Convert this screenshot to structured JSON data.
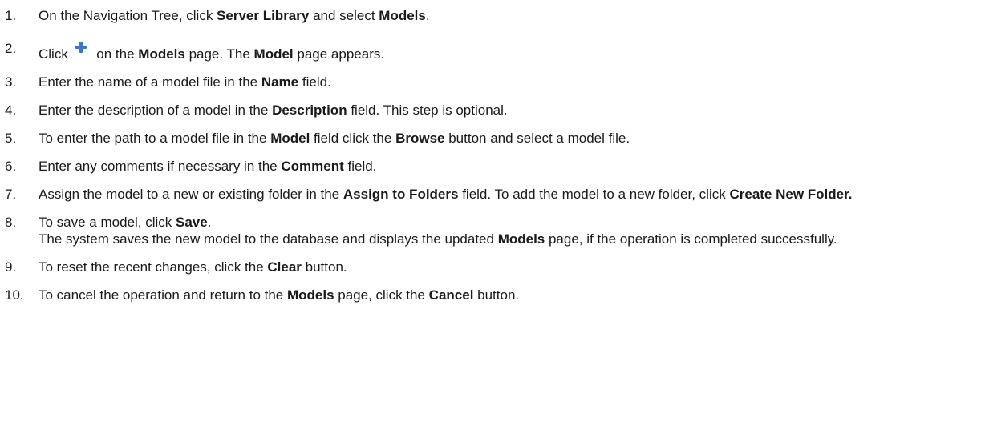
{
  "steps": [
    {
      "num": "1.",
      "parts": [
        "On the Navigation Tree, click ",
        "Server Library",
        " and select ",
        "Models",
        "."
      ]
    },
    {
      "num": "2.",
      "parts": [
        "Click ",
        " on the ",
        "Models",
        " page. The ",
        "Model",
        " page appears."
      ],
      "icon": "plus-icon"
    },
    {
      "num": "3.",
      "parts": [
        "Enter the name of a model file in the ",
        "Name",
        " field."
      ]
    },
    {
      "num": "4.",
      "parts": [
        "Enter the description of a model in the ",
        "Description",
        " field. This step is optional."
      ]
    },
    {
      "num": "5.",
      "parts": [
        "To enter the path to a model file in the ",
        "Model",
        " field click the ",
        "Browse",
        " button and select a model file."
      ]
    },
    {
      "num": "6.",
      "parts": [
        "Enter any comments if necessary in the ",
        "Comment",
        " field."
      ]
    },
    {
      "num": "7.",
      "parts": [
        "Assign the model to a new or existing folder in the ",
        "Assign to Folders",
        " field. To add the model to a new folder, click ",
        "Create New Folder."
      ]
    },
    {
      "num": "8.",
      "parts": [
        "To save a model, click ",
        "Save",
        ".",
        "The system saves the new model to the database and displays the updated ",
        "Models",
        " page, if the operation is completed successfully."
      ]
    },
    {
      "num": "9.",
      "parts": [
        "To reset the recent changes, click the ",
        "Clear",
        " button."
      ]
    },
    {
      "num": "10.",
      "parts": [
        "To cancel the operation and return to the ",
        "Models",
        " page, click the ",
        "Cancel",
        " button."
      ]
    }
  ]
}
